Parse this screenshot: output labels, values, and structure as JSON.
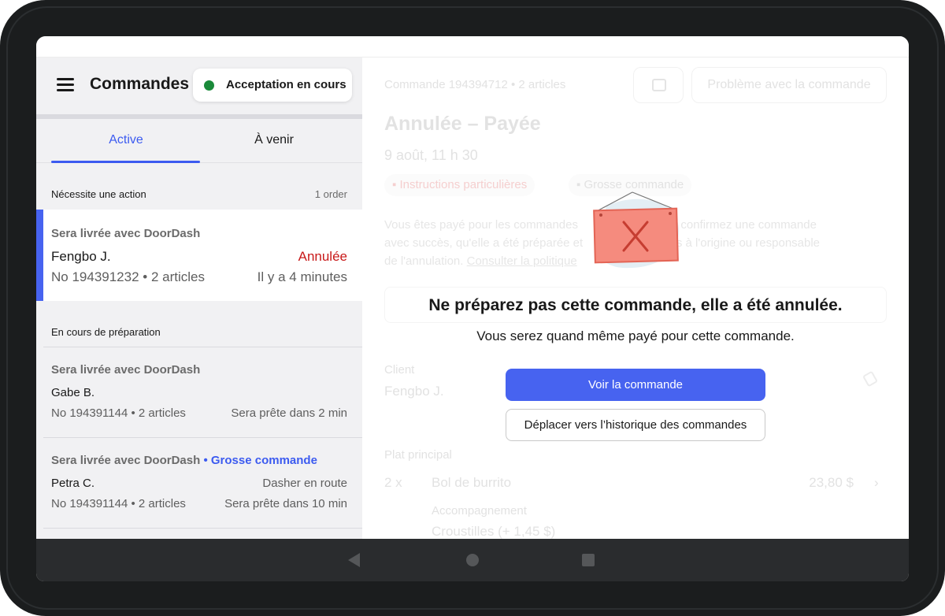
{
  "header": {
    "title": "Commandes",
    "status_label": "Acceptation en cours",
    "status_color": "#1a8a3a"
  },
  "tabs": [
    {
      "label": "Active",
      "active": true
    },
    {
      "label": "À venir",
      "active": false
    }
  ],
  "sections": {
    "action": {
      "title": "Nécessite une action",
      "count": "1 order"
    },
    "preparing": {
      "title": "En cours de préparation"
    }
  },
  "orders": [
    {
      "delivery": "Sera livrée avec DoorDash",
      "tag": "",
      "customer": "Fengbo J.",
      "status": "Annulée",
      "number": "No 194391232 • 2 articles",
      "time": "Il y a 4 minutes"
    },
    {
      "delivery": "Sera livrée avec DoorDash",
      "tag": "",
      "customer": "Gabe B.",
      "status": "",
      "number": "No 194391144 • 2 articles",
      "time": "Sera prête dans 2 min"
    },
    {
      "delivery": "Sera livrée avec DoorDash",
      "tag": "• Grosse commande",
      "customer": "Petra C.",
      "status": "Dasher en route",
      "number": "No 194391144 • 2 articles",
      "time": "Sera prête dans 10 min"
    }
  ],
  "detail": {
    "order_number": "Commande 194394712 • 2 articles",
    "problem_button": "Problème avec la commande",
    "title": "Annulée – Payée",
    "date": "9 août, 11 h 30",
    "chip_instructions": "Instructions particulières",
    "chip_large": "Grosse commande",
    "paragraph_start": "Vous êtes payé pour les commandes",
    "paragraph_mid": "e vous confirmez une commande",
    "paragraph_l2a": "avec succès, qu'elle a été préparée et",
    "paragraph_l2b": "pas à l'origine ou responsable",
    "paragraph_l3": "de l'annulation.",
    "policy_link": "Consulter la politique",
    "client_label": "Client",
    "client_name": "Fengbo J.",
    "main_label": "Plat principal",
    "qty": "2 x",
    "item": "Bol de burrito",
    "price": "23,80 $",
    "side_label": "Accompagnement",
    "side": "Croustilles (+ 1,45 $)"
  },
  "modal": {
    "title": "Ne préparez pas cette commande, elle a été annulée.",
    "subtitle": "Vous serez quand même payé pour cette commande.",
    "primary_button": "Voir la commande",
    "secondary_button": "Déplacer vers l’historique des commandes",
    "accent_color": "#4763f0",
    "illustration": "cancelled-sign-icon"
  }
}
